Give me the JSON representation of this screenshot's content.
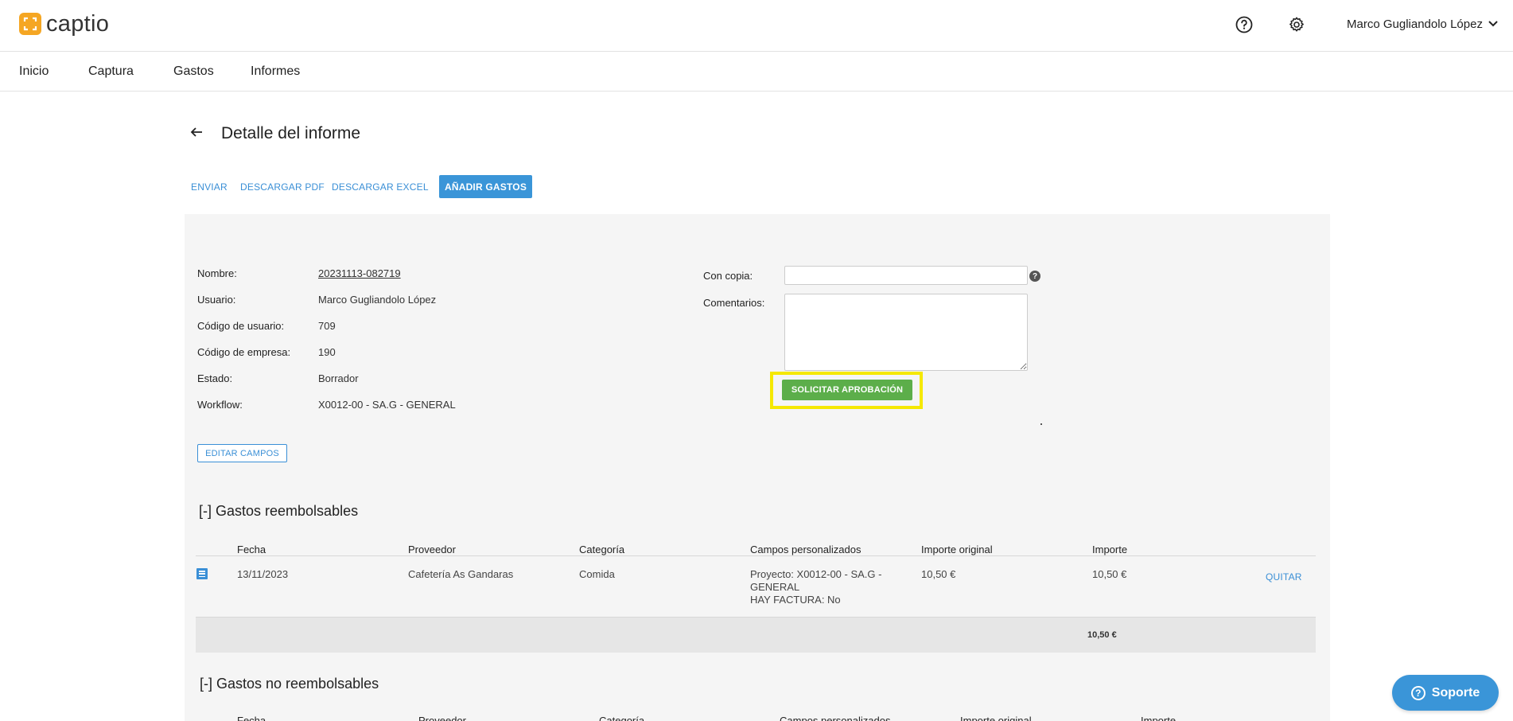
{
  "header": {
    "logo_text": "captio",
    "user_name": "Marco Gugliandolo López",
    "help_icon": "help-circle-icon",
    "settings_icon": "gear-icon"
  },
  "nav": {
    "items": [
      "Inicio",
      "Captura",
      "Gastos",
      "Informes"
    ]
  },
  "page": {
    "title": "Detalle del informe"
  },
  "actions": {
    "enviar": "ENVIAR",
    "pdf": "DESCARGAR PDF",
    "excel": "DESCARGAR EXCEL",
    "add": "AÑADIR GASTOS"
  },
  "report": {
    "fields": [
      {
        "label": "Nombre:",
        "value": "20231113-082719"
      },
      {
        "label": "Usuario:",
        "value": "Marco Gugliandolo López"
      },
      {
        "label": "Código de usuario:",
        "value": "709"
      },
      {
        "label": "Código de empresa:",
        "value": "190"
      },
      {
        "label": "Estado:",
        "value": "Borrador"
      },
      {
        "label": "Workflow:",
        "value": "X0012-00 - SA.G - GENERAL"
      }
    ],
    "cc_label": "Con copia:",
    "cc_value": "",
    "help_glyph": "?",
    "comments_label": "Comentarios:",
    "comments_value": "",
    "approve_label": "SOLICITAR APROBACIÓN",
    "edit_label": "EDITAR CAMPOS"
  },
  "reimbursable": {
    "title": "[-] Gastos reembolsables",
    "columns": [
      "Fecha",
      "Proveedor",
      "Categoría",
      "Campos personalizados",
      "Importe original",
      "Importe"
    ],
    "rows": [
      {
        "fecha": "13/11/2023",
        "proveedor": "Cafetería As Gandaras",
        "categoria": "Comida",
        "campos_1": "Proyecto: X0012-00 - SA.G -",
        "campos_2": "GENERAL",
        "campos_3": "HAY FACTURA: No",
        "importe_original": "10,50 €",
        "importe": "10,50 €",
        "action": "QUITAR"
      }
    ],
    "total": "10,50 €"
  },
  "non_reimbursable": {
    "title": "[-] Gastos no reembolsables",
    "columns": [
      "Fecha",
      "Proveedor",
      "Categoría",
      "Campos personalizados",
      "Importe original",
      "Importe"
    ]
  },
  "support": {
    "label": "Soporte",
    "glyph": "?"
  },
  "colors": {
    "accent": "#3a95d8",
    "approve": "#5cae4a",
    "highlight": "#f5e800",
    "logo": "#f5a623"
  }
}
